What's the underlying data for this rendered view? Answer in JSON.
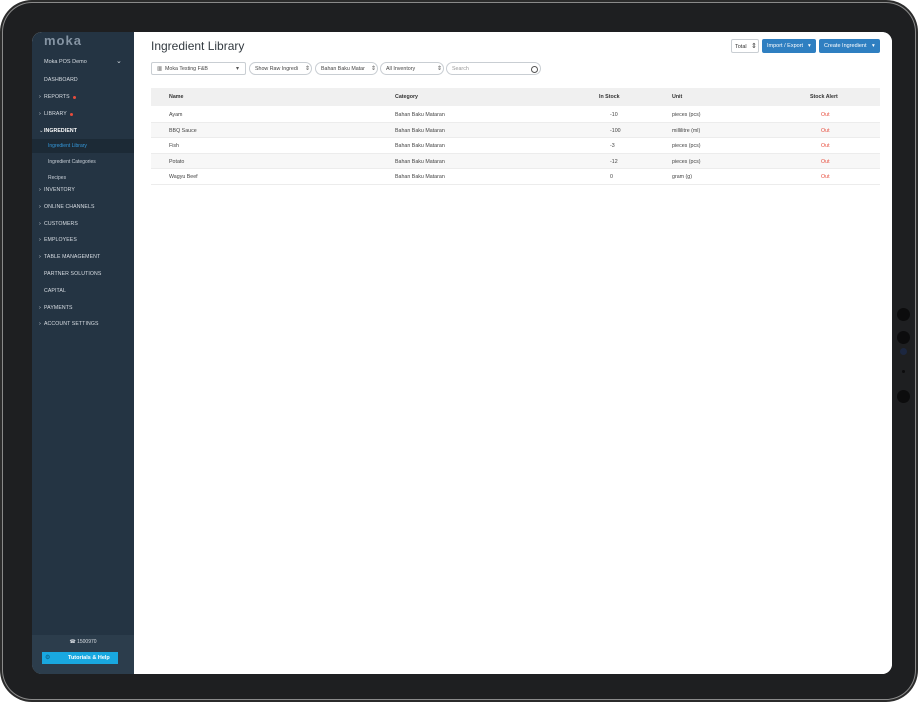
{
  "app": {
    "logo": "moka"
  },
  "sidebar": {
    "outlet": "Moka POS Demo",
    "items": [
      {
        "label": "DASHBOARD",
        "arrow": ""
      },
      {
        "label": "REPORTS",
        "arrow": "›",
        "badge": true
      },
      {
        "label": "LIBRARY",
        "arrow": "›",
        "badge": true
      },
      {
        "label": "INGREDIENT",
        "arrow": "⌄",
        "expanded": true
      }
    ],
    "subitems": [
      {
        "label": "Ingredient Library",
        "active": true
      },
      {
        "label": "Ingredient Categories"
      },
      {
        "label": "Recipes"
      }
    ],
    "items2": [
      {
        "label": "INVENTORY",
        "arrow": "›"
      },
      {
        "label": "ONLINE CHANNELS",
        "arrow": "›"
      },
      {
        "label": "CUSTOMERS",
        "arrow": "›"
      },
      {
        "label": "EMPLOYEES",
        "arrow": "›"
      },
      {
        "label": "TABLE MANAGEMENT",
        "arrow": "›"
      },
      {
        "label": "PARTNER SOLUTIONS",
        "arrow": ""
      },
      {
        "label": "CAPITAL",
        "arrow": ""
      },
      {
        "label": "PAYMENTS",
        "arrow": "›"
      },
      {
        "label": "ACCOUNT SETTINGS",
        "arrow": "›"
      }
    ],
    "footer": {
      "phone": "1500970",
      "help_label": "Tutorials & Help"
    }
  },
  "header": {
    "title": "Ingredient Library",
    "total_label": "Total",
    "import_label": "Import / Export",
    "create_label": "Create Ingredient"
  },
  "filters": {
    "outlet": "Moka Testing F&B",
    "type": "Show Raw Ingredi",
    "category": "Bahan Baku Matar",
    "inventory": "All Inventory",
    "search_placeholder": "Search"
  },
  "table": {
    "headers": [
      "Name",
      "Category",
      "In Stock",
      "Unit",
      "Stock Alert"
    ],
    "rows": [
      {
        "name": "Ayam",
        "category": "Bahan Baku Mataran",
        "stock": "-10",
        "unit": "pieces (pcs)",
        "alert": "Out"
      },
      {
        "name": "BBQ Sauce",
        "category": "Bahan Baku Mataran",
        "stock": "-100",
        "unit": "millilitre (ml)",
        "alert": "Out"
      },
      {
        "name": "Fish",
        "category": "Bahan Baku Mataran",
        "stock": "-3",
        "unit": "pieces (pcs)",
        "alert": "Out"
      },
      {
        "name": "Potato",
        "category": "Bahan Baku Mataran",
        "stock": "-12",
        "unit": "pieces (pcs)",
        "alert": "Out"
      },
      {
        "name": "Wagyu Beef",
        "category": "Bahan Baku Mataran",
        "stock": "0",
        "unit": "gram (g)",
        "alert": "Out"
      }
    ]
  },
  "colors": {
    "sidebar": "#243443",
    "accent": "#2f7fc1",
    "alert": "#e74c3c",
    "help": "#19a8e0"
  }
}
